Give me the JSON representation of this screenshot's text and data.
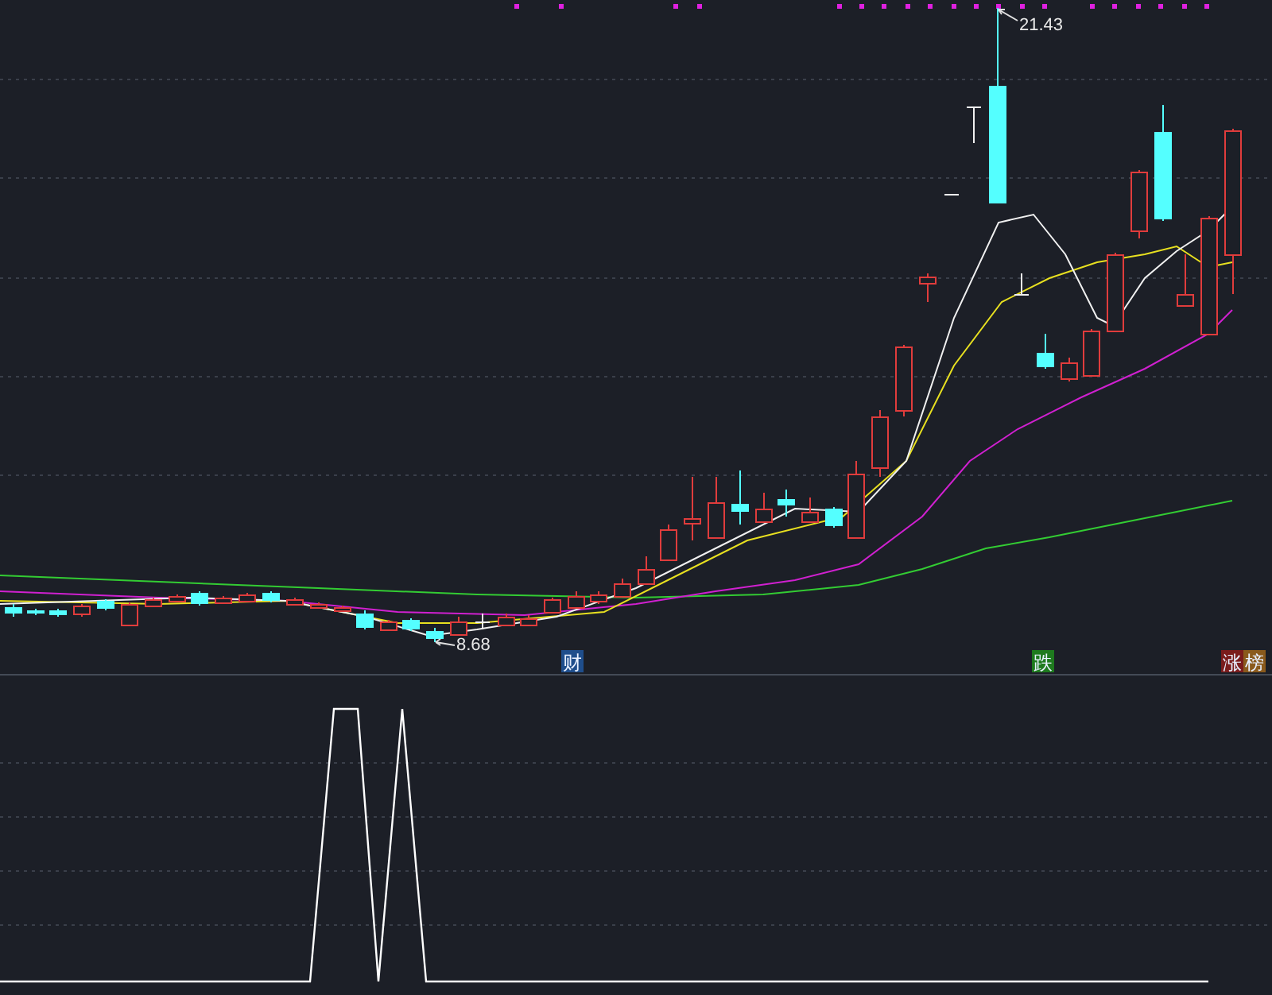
{
  "chart": {
    "high_label": "21.43",
    "low_label": "8.68",
    "tags": [
      {
        "text": "财",
        "color": "#1f4e8c"
      },
      {
        "text": "跌",
        "color": "#1e7a1e"
      },
      {
        "text": "涨",
        "color": "#7a1c1c"
      },
      {
        "text": "榜",
        "color": "#8a5a1c"
      }
    ]
  }
}
